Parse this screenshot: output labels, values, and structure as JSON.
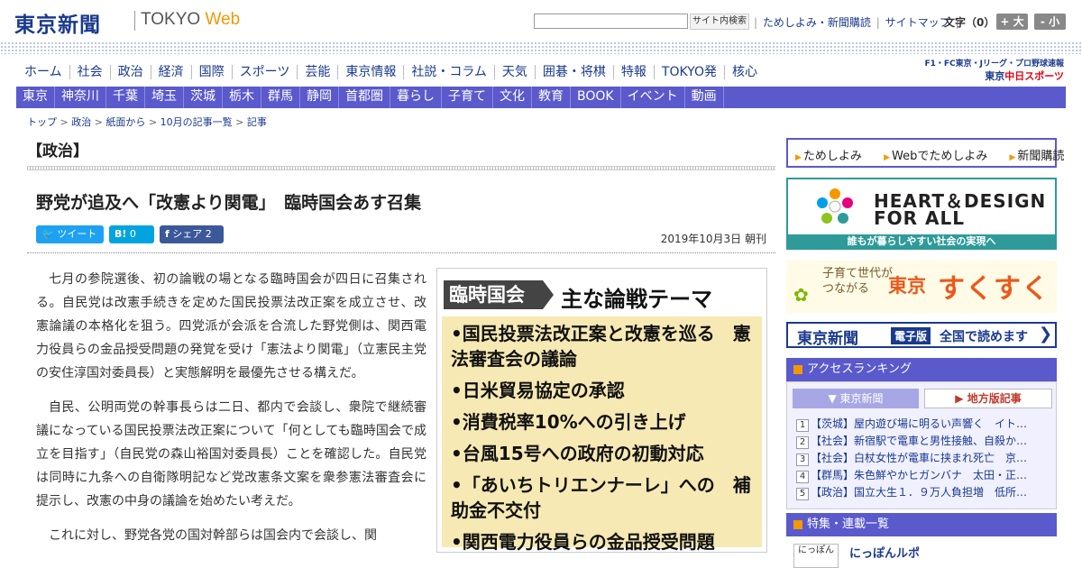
{
  "header": {
    "logo": "東京新聞",
    "logo_tokyo": "TOKYO",
    "logo_web": "Web",
    "search_placeholder": "",
    "search_button": "サイト内検索",
    "links": [
      "ためしよみ・新聞購読",
      "サイトマップ"
    ],
    "font_size_label": "文字（0）",
    "font_bigger": "+ 大",
    "font_smaller": "- 小"
  },
  "main_nav": [
    "ホーム",
    "社会",
    "政治",
    "経済",
    "国際",
    "スポーツ",
    "芸能",
    "東京情報",
    "社説・コラム",
    "天気",
    "囲碁・将棋",
    "特報",
    "TOKYO発",
    "核心"
  ],
  "chunichi": {
    "small": "F1・FC東京・Jリーグ・プロ野球速報",
    "large_prefix": "東京",
    "large_brand": "中日スポーツ"
  },
  "sub_nav": [
    "東京",
    "神奈川",
    "千葉",
    "埼玉",
    "茨城",
    "栃木",
    "群馬",
    "静岡",
    "首都圏",
    "暮らし",
    "子育て",
    "文化",
    "教育",
    "BOOK",
    "イベント",
    "動画"
  ],
  "breadcrumb": [
    "トップ",
    "政治",
    "紙面から",
    "10月の記事一覧",
    "記事"
  ],
  "article": {
    "section": "【政治】",
    "headline": "野党が追及へ「改憲より関電」　臨時国会あす召集",
    "share": {
      "tweet": "ツイート",
      "hatena": "B!",
      "hatena_count": "0",
      "facebook": "シェア",
      "facebook_count": "2"
    },
    "date": "2019年10月3日 朝刊",
    "paragraphs": [
      "七月の参院選後、初の論戦の場となる臨時国会が四日に召集される。自民党は改憲手続きを定めた国民投票法改正案を成立させ、改憲論議の本格化を狙う。四党派が会派を合流した野党側は、関西電力役員らの金品授受問題の発覚を受け「憲法より関電」（立憲民主党の安住淳国対委員長）と実態解明を最優先させる構えだ。",
      "自民、公明両党の幹事長らは二日、都内で会談し、衆院で継続審議になっている国民投票法改正案について「何としても臨時国会で成立を目指す」（自民党の森山裕国対委員長）ことを確認した。自民党は同時に九条への自衛隊明記など党改憲条文案を衆参憲法審査会に提示し、改憲の中身の議論を始めたい考えだ。",
      "これに対し、野党各党の国対幹部らは国会内で会談し、関"
    ],
    "figure": {
      "tag": "臨時国会",
      "title": "主な論戦テーマ",
      "items": [
        "•国民投票法改正案と改憲を巡る　憲法審査会の議論",
        "•日米貿易協定の承認",
        "•消費税率10%への引き上げ",
        "•台風15号への政府の初動対応",
        "•「あいちトリエンナーレ」への　補助金不交付",
        "•関西電力役員らの金品授受問題"
      ]
    }
  },
  "sidebar": {
    "tabs": [
      "ためしよみ",
      "Webでためしよみ",
      "新聞購読"
    ],
    "heart": {
      "line1": "HEART＆DESIGN",
      "line2": "FOR ALL",
      "bar": "誰もが暮らしやすい社会の実現へ"
    },
    "sukusuku": {
      "small": "子育て世代が\nつながる",
      "tokyo": "東京",
      "big": "すくすく"
    },
    "epaper": {
      "logo": "東京新聞",
      "tag": "電子版",
      "text": "全国で読めます",
      "arrow": "❯"
    },
    "ranking": {
      "title": "アクセスランキング",
      "tab_active": "東京新聞",
      "tab_other": "地方版記事",
      "items": [
        {
          "n": "1",
          "text": "【茨城】屋内遊び場に明るい声響く　イト…"
        },
        {
          "n": "2",
          "text": "【社会】新宿駅で電車と男性接触、自殺か…"
        },
        {
          "n": "3",
          "text": "【社会】白杖女性が電車に挟まれ死亡　京…"
        },
        {
          "n": "4",
          "text": "【群馬】朱色鮮やかヒガンバナ　太田・正…"
        },
        {
          "n": "5",
          "text": "【政治】国立大生１．９万人負担増　低所…"
        }
      ]
    },
    "features": {
      "title": "特集・連載一覧",
      "item_img": "にっぽん",
      "item_title": "にっぽんルポ"
    }
  }
}
